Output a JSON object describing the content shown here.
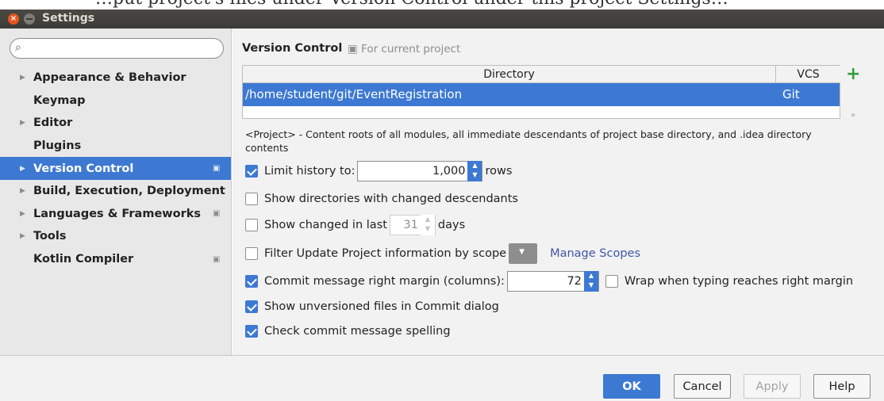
{
  "caption_crop": "…put project's files under Version Control under this project Settings…",
  "window": {
    "title": "Settings",
    "close_glyph": "×"
  },
  "search": {
    "placeholder": "",
    "icon": "search-icon"
  },
  "sidebar": {
    "items": [
      {
        "label": "Appearance & Behavior",
        "expandable": true,
        "project_icon": false,
        "selected": false
      },
      {
        "label": "Keymap",
        "expandable": false,
        "project_icon": false,
        "selected": false
      },
      {
        "label": "Editor",
        "expandable": true,
        "project_icon": false,
        "selected": false
      },
      {
        "label": "Plugins",
        "expandable": false,
        "project_icon": false,
        "selected": false
      },
      {
        "label": "Version Control",
        "expandable": true,
        "project_icon": true,
        "selected": true
      },
      {
        "label": "Build, Execution, Deployment",
        "expandable": true,
        "project_icon": false,
        "selected": false
      },
      {
        "label": "Languages & Frameworks",
        "expandable": true,
        "project_icon": true,
        "selected": false
      },
      {
        "label": "Tools",
        "expandable": true,
        "project_icon": false,
        "selected": false
      },
      {
        "label": "Kotlin Compiler",
        "expandable": false,
        "project_icon": true,
        "selected": false
      }
    ]
  },
  "main": {
    "heading": "Version Control",
    "heading_note": "For current project",
    "table": {
      "headers": [
        "Directory",
        "VCS"
      ],
      "rows": [
        {
          "directory": "/home/student/git/EventRegistration",
          "vcs": "Git",
          "selected": true
        }
      ],
      "add_glyph": "+",
      "more_glyph": "»"
    },
    "description": "<Project> - Content roots of all modules, all immediate descendants of project base directory, and .idea directory contents",
    "options": {
      "limit_history": {
        "checked": true,
        "label": "Limit history to:",
        "value": "1,000",
        "suffix": "rows"
      },
      "show_dirs": {
        "checked": false,
        "label": "Show directories with changed descendants"
      },
      "show_changed": {
        "checked": false,
        "label": "Show changed in last",
        "value": "31",
        "suffix": "days"
      },
      "filter_update": {
        "checked": false,
        "label": "Filter Update Project information by scope",
        "link": "Manage Scopes"
      },
      "commit_margin": {
        "checked": true,
        "label": "Commit message right margin (columns):",
        "value": "72"
      },
      "wrap_typing": {
        "checked": false,
        "label": "Wrap when typing reaches right margin"
      },
      "show_unversioned": {
        "checked": true,
        "label": "Show unversioned files in Commit dialog"
      },
      "check_spelling": {
        "checked": true,
        "label": "Check commit message spelling"
      }
    }
  },
  "footer": {
    "ok": "OK",
    "cancel": "Cancel",
    "apply": "Apply",
    "help": "Help"
  },
  "colors": {
    "accent": "#3d79d2",
    "add_green": "#2e9e3f",
    "link": "#3f57a8"
  }
}
